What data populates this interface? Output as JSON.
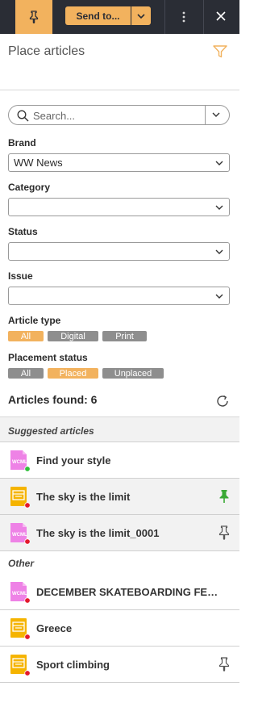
{
  "toolbar": {
    "send_label": "Send to...",
    "icons": {
      "pin": "pin-icon",
      "caret": "caret-down-icon",
      "menu": "kebab-icon",
      "close": "close-icon"
    },
    "accent": "#f2b25e",
    "background": "#2a2d35"
  },
  "panel": {
    "title": "Place articles"
  },
  "search": {
    "placeholder": "Search..."
  },
  "filters": {
    "brand": {
      "label": "Brand",
      "value": "WW News"
    },
    "category": {
      "label": "Category",
      "value": ""
    },
    "status": {
      "label": "Status",
      "value": ""
    },
    "issue": {
      "label": "Issue",
      "value": ""
    },
    "article_type": {
      "label": "Article type",
      "options": [
        {
          "label": "All",
          "active": true
        },
        {
          "label": "Digital",
          "active": false
        },
        {
          "label": "Print",
          "active": false
        }
      ]
    },
    "placement_status": {
      "label": "Placement status",
      "options": [
        {
          "label": "All",
          "active": false
        },
        {
          "label": "Placed",
          "active": true
        },
        {
          "label": "Unplaced",
          "active": false
        }
      ]
    }
  },
  "results": {
    "label": "Articles found: 6",
    "sections": [
      {
        "heading": "Suggested articles",
        "items": [
          {
            "name": "Find your style",
            "file_type": "WCML",
            "status_color": "#2fbf3a",
            "pinned": null,
            "highlighted": false
          },
          {
            "name": "The sky is the limit",
            "file_type": "layout",
            "status_color": "#e3192c",
            "pinned": "green",
            "highlighted": true
          },
          {
            "name": "The sky is the limit_0001",
            "file_type": "WCML",
            "status_color": "#e3192c",
            "pinned": "gray",
            "highlighted": true
          }
        ]
      },
      {
        "heading": "Other",
        "items": [
          {
            "name": "DECEMBER SKATEBOARDING FEATURE",
            "file_type": "WCML",
            "status_color": "#e3192c",
            "pinned": null,
            "highlighted": false
          },
          {
            "name": "Greece",
            "file_type": "layout",
            "status_color": "#e3192c",
            "pinned": null,
            "highlighted": false
          },
          {
            "name": "Sport climbing",
            "file_type": "layout",
            "status_color": "#e3192c",
            "pinned": "gray",
            "highlighted": false
          }
        ]
      }
    ]
  }
}
